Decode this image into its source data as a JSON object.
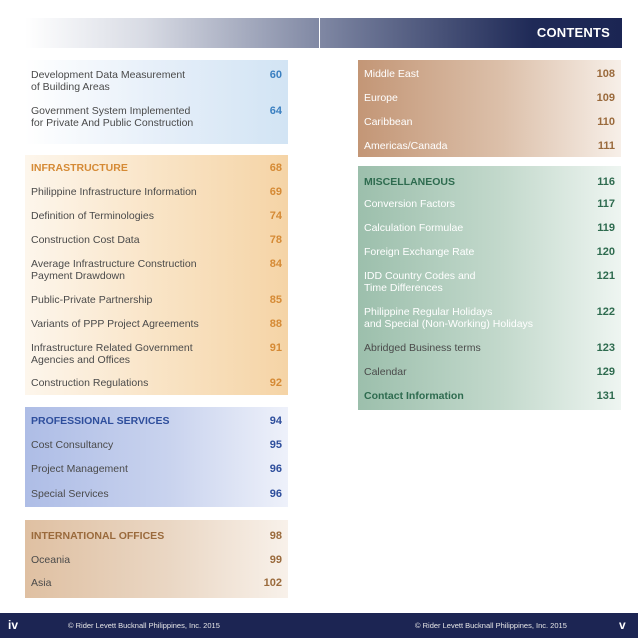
{
  "header": {
    "title": "CONTENTS"
  },
  "colors": {
    "blue_panel": "#dbe9f6",
    "orange_panel": "#f7dcb6",
    "orange_accent": "#d58a35",
    "professional_panel": "#b7c4e8",
    "professional_accent": "#2e4e9c",
    "international_panel": "#e4cab1",
    "international_accent": "#9a6a3c",
    "regions_panel": "#c79a78",
    "misc_panel": "#9fc0ae",
    "misc_accent": "#2e6b4f",
    "footer_bg": "#1c2553"
  },
  "left": {
    "top_section": {
      "items": [
        {
          "label": "Development Data Measurement\nof Building Areas",
          "page": "60"
        },
        {
          "label": "Government System Implemented\nfor Private And Public Construction",
          "page": "64"
        }
      ]
    },
    "infrastructure": {
      "heading": "INFRASTRUCTURE",
      "heading_page": "68",
      "items": [
        {
          "label": "Philippine Infrastructure Information",
          "page": "69"
        },
        {
          "label": "Definition of Terminologies",
          "page": "74"
        },
        {
          "label": "Construction Cost Data",
          "page": "78"
        },
        {
          "label": "Average Infrastructure Construction\nPayment Drawdown",
          "page": "84"
        },
        {
          "label": "Public-Private Partnership",
          "page": "85"
        },
        {
          "label": "Variants of PPP Project Agreements",
          "page": "88"
        },
        {
          "label": "Infrastructure Related Government\nAgencies and Offices",
          "page": "91"
        },
        {
          "label": "Construction Regulations",
          "page": "92"
        }
      ]
    },
    "professional_services": {
      "heading": "PROFESSIONAL SERVICES",
      "heading_page": "94",
      "items": [
        {
          "label": "Cost Consultancy",
          "page": "95"
        },
        {
          "label": "Project Management",
          "page": "96"
        },
        {
          "label": "Special Services",
          "page": "96"
        }
      ]
    },
    "international_offices": {
      "heading": "INTERNATIONAL OFFICES",
      "heading_page": "98",
      "items": [
        {
          "label": "Oceania",
          "page": "99"
        },
        {
          "label": "Asia",
          "page": "102"
        }
      ]
    }
  },
  "right": {
    "regions": {
      "items": [
        {
          "label": "Middle East",
          "page": "108"
        },
        {
          "label": "Europe",
          "page": "109"
        },
        {
          "label": "Caribbean",
          "page": "110"
        },
        {
          "label": "Americas/Canada",
          "page": "111"
        }
      ]
    },
    "miscellaneous": {
      "heading": "MISCELLANEOUS",
      "heading_page": "116",
      "items": [
        {
          "label": "Conversion Factors",
          "page": "117"
        },
        {
          "label": "Calculation Formulae",
          "page": "119"
        },
        {
          "label": "Foreign Exchange Rate",
          "page": "120"
        },
        {
          "label": "IDD Country Codes and\nTime Differences",
          "page": "121"
        },
        {
          "label": "Philippine Regular Holidays\nand Special (Non-Working) Holidays",
          "page": "122"
        },
        {
          "label": "Abridged Business terms",
          "page": "123"
        },
        {
          "label": "Calendar",
          "page": "129"
        },
        {
          "label": "Contact Information",
          "page": "131"
        }
      ]
    }
  },
  "footer": {
    "left_page": "iv",
    "left_copy": "© Rider Levett Bucknall Philippines, Inc. 2015",
    "right_copy": "© Rider Levett Bucknall Philippines, Inc. 2015",
    "right_page": "v"
  }
}
